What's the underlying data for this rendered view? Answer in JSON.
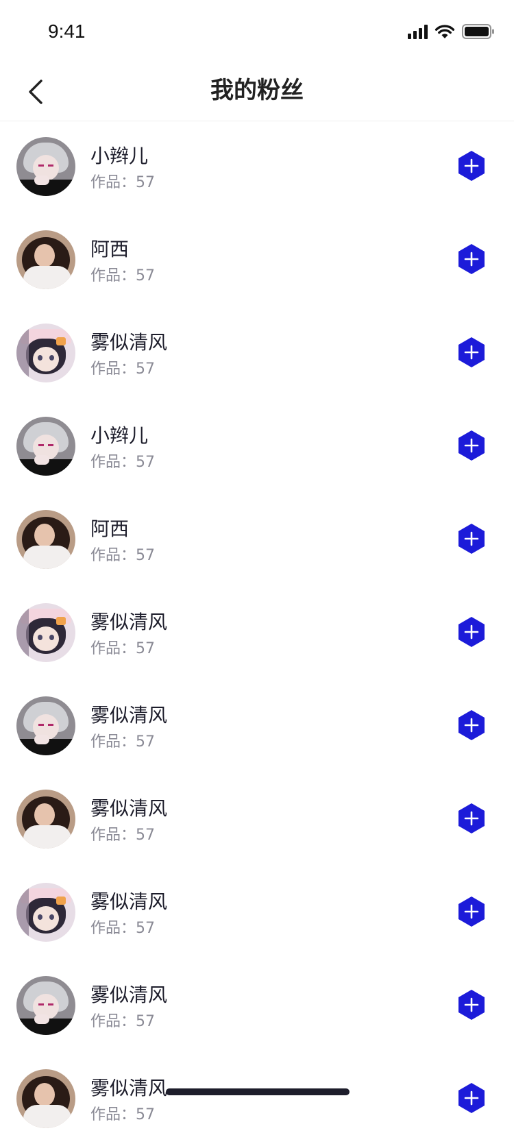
{
  "status_bar": {
    "time": "9:41"
  },
  "nav": {
    "title": "我的粉丝"
  },
  "colors": {
    "accent": "#1c1bd9",
    "name_text": "#1d1d2b",
    "sub_text": "#8a8a95"
  },
  "fans": [
    {
      "name": "小辫儿",
      "works_label": "作品：",
      "works_count": "57",
      "avatar": "silver-hair-boy"
    },
    {
      "name": "阿西",
      "works_label": "作品：",
      "works_count": "57",
      "avatar": "curly-hair-girl"
    },
    {
      "name": "雾似清风",
      "works_label": "作品：",
      "works_count": "57",
      "avatar": "anime-girl"
    },
    {
      "name": "小辫儿",
      "works_label": "作品：",
      "works_count": "57",
      "avatar": "silver-hair-boy"
    },
    {
      "name": "阿西",
      "works_label": "作品：",
      "works_count": "57",
      "avatar": "curly-hair-girl"
    },
    {
      "name": "雾似清风",
      "works_label": "作品：",
      "works_count": "57",
      "avatar": "anime-girl"
    },
    {
      "name": "雾似清风",
      "works_label": "作品：",
      "works_count": "57",
      "avatar": "silver-hair-boy"
    },
    {
      "name": "雾似清风",
      "works_label": "作品：",
      "works_count": "57",
      "avatar": "curly-hair-girl"
    },
    {
      "name": "雾似清风",
      "works_label": "作品：",
      "works_count": "57",
      "avatar": "anime-girl"
    },
    {
      "name": "雾似清风",
      "works_label": "作品：",
      "works_count": "57",
      "avatar": "silver-hair-boy"
    },
    {
      "name": "雾似清风",
      "works_label": "作品：",
      "works_count": "57",
      "avatar": "curly-hair-girl"
    }
  ]
}
